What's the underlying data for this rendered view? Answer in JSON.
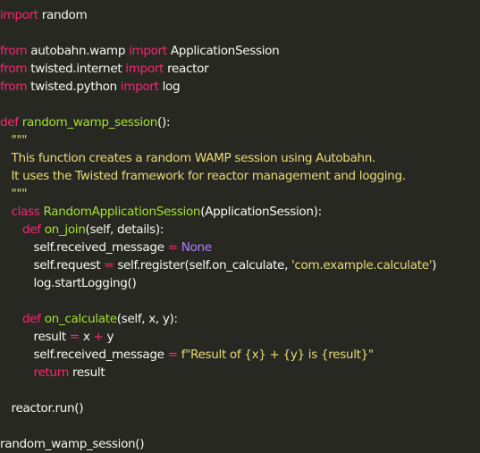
{
  "editor": {
    "theme": {
      "background": "#272822",
      "text": "#f8f8f2",
      "keyword": "#f92672",
      "function": "#a6e22e",
      "string": "#e6db74",
      "constant": "#ae81ff"
    },
    "lines": [
      {
        "indent": 0,
        "tokens": [
          {
            "t": "import",
            "c": "kw"
          },
          {
            "t": " random",
            "c": "id"
          }
        ]
      },
      null,
      {
        "indent": 0,
        "tokens": [
          {
            "t": "from",
            "c": "kw"
          },
          {
            "t": " autobahn.wamp ",
            "c": "id"
          },
          {
            "t": "import",
            "c": "kw"
          },
          {
            "t": " ApplicationSession",
            "c": "id"
          }
        ]
      },
      {
        "indent": 0,
        "tokens": [
          {
            "t": "from",
            "c": "kw"
          },
          {
            "t": " twisted.internet ",
            "c": "id"
          },
          {
            "t": "import",
            "c": "kw"
          },
          {
            "t": " reactor",
            "c": "id"
          }
        ]
      },
      {
        "indent": 0,
        "tokens": [
          {
            "t": "from",
            "c": "kw"
          },
          {
            "t": " twisted.python ",
            "c": "id"
          },
          {
            "t": "import",
            "c": "kw"
          },
          {
            "t": " log",
            "c": "id"
          }
        ]
      },
      null,
      {
        "indent": 0,
        "tokens": [
          {
            "t": "def",
            "c": "kw"
          },
          {
            "t": " ",
            "c": "id"
          },
          {
            "t": "random_wamp_session",
            "c": "fn"
          },
          {
            "t": "():",
            "c": "id"
          }
        ]
      },
      {
        "indent": 1,
        "tokens": [
          {
            "t": "\"\"\"",
            "c": "str"
          }
        ]
      },
      {
        "indent": 1,
        "tokens": [
          {
            "t": "This function creates a random WAMP session using Autobahn.",
            "c": "str"
          }
        ]
      },
      {
        "indent": 1,
        "tokens": [
          {
            "t": "It uses the Twisted framework for reactor management and logging.",
            "c": "str"
          }
        ]
      },
      {
        "indent": 1,
        "tokens": [
          {
            "t": "\"\"\"",
            "c": "str"
          }
        ]
      },
      {
        "indent": 1,
        "tokens": [
          {
            "t": "class",
            "c": "kw"
          },
          {
            "t": " ",
            "c": "id"
          },
          {
            "t": "RandomApplicationSession",
            "c": "fn"
          },
          {
            "t": "(ApplicationSession):",
            "c": "id"
          }
        ]
      },
      {
        "indent": 2,
        "tokens": [
          {
            "t": "def",
            "c": "kw"
          },
          {
            "t": " ",
            "c": "id"
          },
          {
            "t": "on_join",
            "c": "fn"
          },
          {
            "t": "(self, details):",
            "c": "id"
          }
        ]
      },
      {
        "indent": 3,
        "tokens": [
          {
            "t": "self.received_message ",
            "c": "id"
          },
          {
            "t": "=",
            "c": "kw"
          },
          {
            "t": " ",
            "c": "id"
          },
          {
            "t": "None",
            "c": "const"
          }
        ]
      },
      {
        "indent": 3,
        "tokens": [
          {
            "t": "self.request ",
            "c": "id"
          },
          {
            "t": "=",
            "c": "kw"
          },
          {
            "t": " self.register(self.on_calculate, ",
            "c": "id"
          },
          {
            "t": "'com.example.calculate'",
            "c": "str"
          },
          {
            "t": ")",
            "c": "id"
          }
        ]
      },
      {
        "indent": 3,
        "tokens": [
          {
            "t": "log.startLogging()",
            "c": "id"
          }
        ]
      },
      null,
      {
        "indent": 2,
        "tokens": [
          {
            "t": "def",
            "c": "kw"
          },
          {
            "t": " ",
            "c": "id"
          },
          {
            "t": "on_calculate",
            "c": "fn"
          },
          {
            "t": "(self, x, y):",
            "c": "id"
          }
        ]
      },
      {
        "indent": 3,
        "tokens": [
          {
            "t": "result ",
            "c": "id"
          },
          {
            "t": "=",
            "c": "kw"
          },
          {
            "t": " x ",
            "c": "id"
          },
          {
            "t": "+",
            "c": "kw"
          },
          {
            "t": " y",
            "c": "id"
          }
        ]
      },
      {
        "indent": 3,
        "tokens": [
          {
            "t": "self.received_message ",
            "c": "id"
          },
          {
            "t": "=",
            "c": "kw"
          },
          {
            "t": " ",
            "c": "id"
          },
          {
            "t": "f\"Result of {x} + {y} is {result}\"",
            "c": "str"
          }
        ]
      },
      {
        "indent": 3,
        "tokens": [
          {
            "t": "return",
            "c": "kw"
          },
          {
            "t": " result",
            "c": "id"
          }
        ]
      },
      null,
      {
        "indent": 1,
        "tokens": [
          {
            "t": "reactor.run()",
            "c": "id"
          }
        ]
      },
      null,
      {
        "indent": 0,
        "tokens": [
          {
            "t": "random_wamp_session()",
            "c": "id"
          }
        ]
      }
    ]
  }
}
